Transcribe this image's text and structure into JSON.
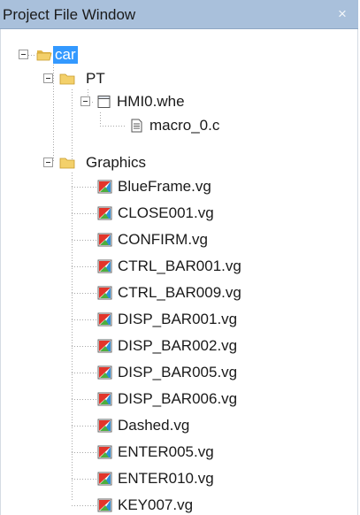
{
  "window": {
    "title": "Project File Window",
    "close_glyph": "×"
  },
  "tree": {
    "root": {
      "label": "car",
      "icon": "folder-open-icon",
      "selected": true
    },
    "pt_folder": {
      "label": "PT",
      "icon": "folder-icon"
    },
    "hmi_file": {
      "label": "HMI0.whe",
      "icon": "window-file-icon"
    },
    "macro_file": {
      "label": "macro_0.c",
      "icon": "source-file-icon"
    },
    "graphics_folder": {
      "label": "Graphics",
      "icon": "folder-icon"
    },
    "graphics_items": [
      "BlueFrame.vg",
      "CLOSE001.vg",
      "CONFIRM.vg",
      "CTRL_BAR001.vg",
      "CTRL_BAR009.vg",
      "DISP_BAR001.vg",
      "DISP_BAR002.vg",
      "DISP_BAR005.vg",
      "DISP_BAR006.vg",
      "Dashed.vg",
      "ENTER005.vg",
      "ENTER010.vg",
      "KEY007.vg"
    ]
  },
  "colors": {
    "titlebar": "#a9c0db",
    "selection": "#3399ff",
    "folder": "#f3d06a"
  }
}
